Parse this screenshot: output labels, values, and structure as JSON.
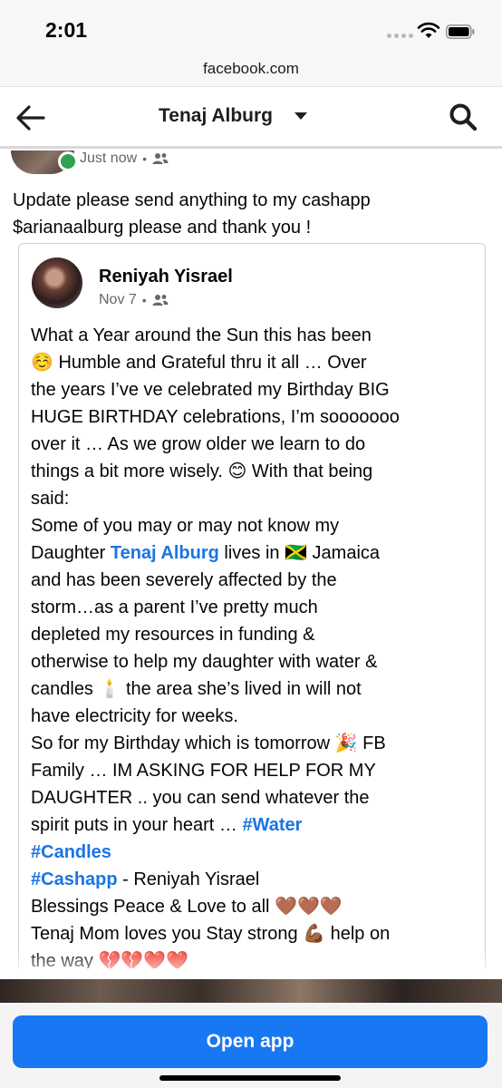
{
  "status_bar": {
    "time": "2:01"
  },
  "browser": {
    "url": "facebook.com"
  },
  "nav": {
    "title": "Tenaj Alburg"
  },
  "post": {
    "timestamp": "Just now",
    "separator": "•",
    "text_lines": [
      "Update please send anything to my cashapp",
      "$arianaalburg please and thank you !"
    ]
  },
  "shared_post": {
    "author": "Reniyah Yisrael",
    "timestamp": "Nov 7",
    "separator": "•",
    "lines": [
      [
        {
          "t": "What a Year around the Sun this has been"
        }
      ],
      [
        {
          "t": "☺️ Humble and Grateful thru it all … Over"
        }
      ],
      [
        {
          "t": "the years I’ve ve celebrated my Birthday BIG"
        }
      ],
      [
        {
          "t": "HUGE BIRTHDAY celebrations, I’m sooooooo"
        }
      ],
      [
        {
          "t": "over it … As we grow older we learn to do"
        }
      ],
      [
        {
          "t": "things a bit more wisely. 😊 With that being"
        }
      ],
      [
        {
          "t": "said:"
        }
      ],
      [
        {
          "t": "Some of you may or may not know my"
        }
      ],
      [
        {
          "t": "Daughter "
        },
        {
          "t": "Tenaj Alburg",
          "link": true
        },
        {
          "t": " lives in 🇯🇲 Jamaica"
        }
      ],
      [
        {
          "t": "and has been severely affected by the"
        }
      ],
      [
        {
          "t": "storm…as a parent I’ve pretty much"
        }
      ],
      [
        {
          "t": "depleted my resources in funding &"
        }
      ],
      [
        {
          "t": "otherwise to help my daughter with water &"
        }
      ],
      [
        {
          "t": "candles 🕯️ the area she’s lived in will not"
        }
      ],
      [
        {
          "t": "have electricity for weeks."
        }
      ],
      [
        {
          "t": "So for my Birthday which is tomorrow 🎉 FB"
        }
      ],
      [
        {
          "t": "Family … IM ASKING FOR HELP FOR MY"
        }
      ],
      [
        {
          "t": "DAUGHTER .. you can send whatever the"
        }
      ],
      [
        {
          "t": "spirit puts in your heart … "
        },
        {
          "t": "#Water",
          "link": true
        }
      ],
      [
        {
          "t": "#Candles",
          "link": true
        }
      ],
      [
        {
          "t": "#Cashapp",
          "link": true
        },
        {
          "t": " - Reniyah Yisrael"
        }
      ],
      [
        {
          "t": "Blessings Peace & Love to all 🤎🤎🤎"
        }
      ],
      [
        {
          "t": "Tenaj Mom loves you Stay strong 💪🏾 help on"
        }
      ],
      [
        {
          "t": "the way 💔💔❤️❤️"
        }
      ]
    ]
  },
  "footer": {
    "open_app_label": "Open app"
  },
  "colors": {
    "accent": "#1877f2",
    "link": "#1b74e4",
    "online": "#31a24c"
  }
}
